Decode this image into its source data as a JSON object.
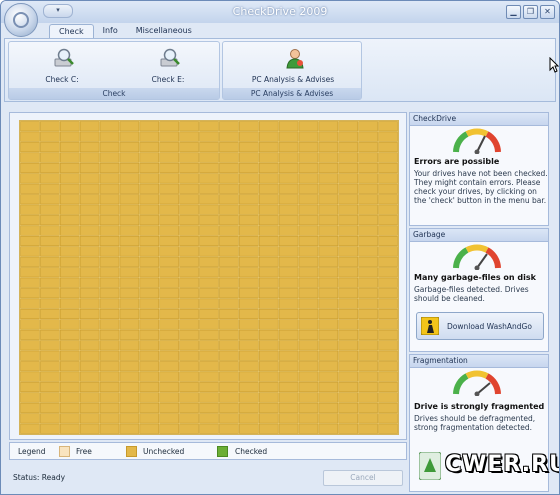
{
  "window": {
    "title": "CheckDrive 2009",
    "quick_access": "▾",
    "minimize": "▁",
    "restore": "❐",
    "close": "✕"
  },
  "ribbon": {
    "tabs": [
      {
        "label": "Check",
        "active": true
      },
      {
        "label": "Info"
      },
      {
        "label": "Miscellaneous"
      }
    ],
    "groups": [
      {
        "label": "Check",
        "buttons": [
          {
            "label": "Check C:",
            "icon": "magnifier-drive-icon"
          },
          {
            "label": "Check E:",
            "icon": "magnifier-drive-icon"
          }
        ]
      },
      {
        "label": "PC Analysis & Advises",
        "buttons": [
          {
            "label": "PC Analysis & Advises",
            "icon": "person-icon"
          }
        ]
      }
    ]
  },
  "legend": {
    "title": "Legend",
    "items": [
      {
        "label": "Free",
        "color": "#f9e4bf"
      },
      {
        "label": "Unchecked",
        "color": "#e3b84a"
      },
      {
        "label": "Checked",
        "color": "#6cae35"
      }
    ]
  },
  "status": {
    "text": "Status: Ready",
    "cancel_label": "Cancel"
  },
  "sidebar": {
    "checkdrive": {
      "header": "CheckDrive",
      "title": "Errors are possible",
      "text": "Your drives have not been checked. They might contain errors. Please check your drives, by clicking on the 'check' button in the menu bar."
    },
    "garbage": {
      "header": "Garbage",
      "title": "Many garbage-files on disk",
      "text": "Garbage-files detected. Drives should be cleaned.",
      "button_label": "Download WashAndGo"
    },
    "fragmentation": {
      "header": "Fragmentation",
      "title": "Drive is strongly fragmented",
      "text": "Drives should be defragmented, strong fragmentation detected."
    }
  },
  "watermark": {
    "text": "CWER.RU"
  },
  "colors": {
    "block_unchecked": "#e3b84a",
    "block_border": "#c79a2c",
    "accent": "#c3d4ec"
  }
}
